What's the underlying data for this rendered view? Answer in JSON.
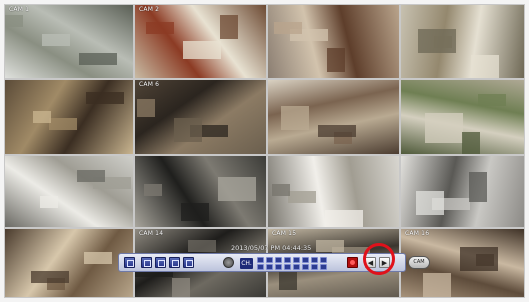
{
  "cameras": [
    {
      "label": "CAM 1",
      "colors": [
        "#dfe1dd",
        "#8a8f82",
        "#b9bdb5",
        "#5a5f55"
      ]
    },
    {
      "label": "CAM 2",
      "colors": [
        "#c8bba4",
        "#8c3b24",
        "#e8e2d2",
        "#6d4a33"
      ]
    },
    {
      "label": "",
      "colors": [
        "#8b7e72",
        "#d2c3ad",
        "#5e3e2b",
        "#b9a48c"
      ]
    },
    {
      "label": "",
      "colors": [
        "#c7c1b0",
        "#94886e",
        "#e5e0d2",
        "#6e6855"
      ]
    },
    {
      "label": "",
      "colors": [
        "#5b4b38",
        "#a08a66",
        "#3b2e22",
        "#c9b590"
      ]
    },
    {
      "label": "CAM 6",
      "colors": [
        "#4f4336",
        "#2b251f",
        "#8c7b64",
        "#6b5f4e"
      ]
    },
    {
      "label": "",
      "colors": [
        "#d9d1c2",
        "#7b6450",
        "#b9aa92",
        "#4b3c30"
      ]
    },
    {
      "label": "",
      "colors": [
        "#aea894",
        "#6f7f53",
        "#d4cfbf",
        "#4f5a3a"
      ]
    },
    {
      "label": "",
      "colors": [
        "#cfcfca",
        "#9f9d94",
        "#ecebe6",
        "#6a6963"
      ]
    },
    {
      "label": "",
      "colors": [
        "#3c3c38",
        "#7d7a72",
        "#1f1f1d",
        "#a8a59c"
      ]
    },
    {
      "label": "",
      "colors": [
        "#d8d6d0",
        "#a19d92",
        "#f1efea",
        "#77746c"
      ]
    },
    {
      "label": "",
      "colors": [
        "#8c8a86",
        "#c9c8c4",
        "#5a5955",
        "#e2e1dd"
      ]
    },
    {
      "label": "",
      "colors": [
        "#b8a68b",
        "#6f5a43",
        "#d7c7ab",
        "#4a3b2d"
      ]
    },
    {
      "label": "CAM 14",
      "colors": [
        "#3b3a36",
        "#6e6a61",
        "#1e1d1b",
        "#8f8a80"
      ]
    },
    {
      "label": "CAM 15",
      "colors": [
        "#615a4f",
        "#9a8f7d",
        "#3a352e",
        "#bfb4a0"
      ]
    },
    {
      "label": "CAM 16",
      "colors": [
        "#a6927a",
        "#5e4c3b",
        "#c9b8a1",
        "#3f3227"
      ]
    }
  ],
  "timestamp": "2013/05/07 PM 04:44:35",
  "toolbar": {
    "ch_label": "CH.",
    "prev_glyph": "◀",
    "next_glyph": "▶"
  },
  "cam_toggle_label": "CAM",
  "colors": {
    "highlight": "#e0111b",
    "toolbar_button": "#2d3c91",
    "record": "#b20e0e"
  }
}
